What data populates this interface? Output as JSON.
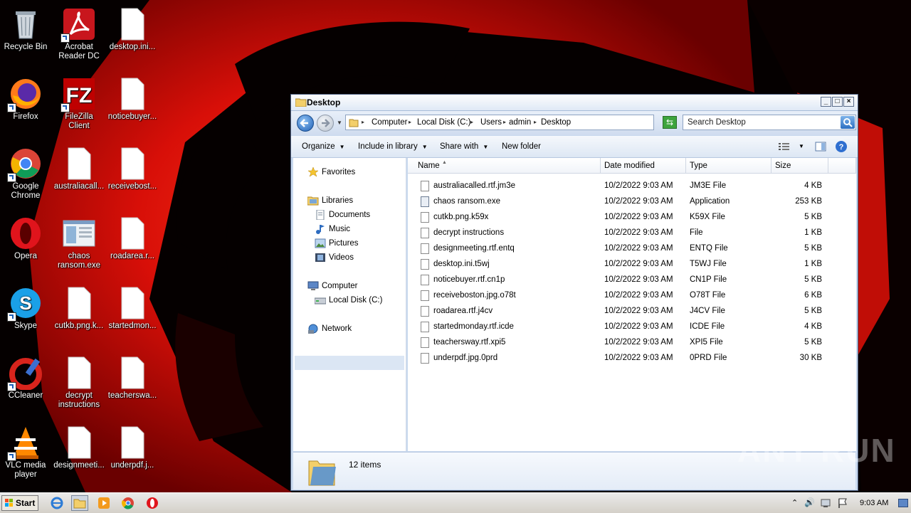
{
  "desktop": {
    "icons": [
      {
        "label": "Recycle Bin",
        "icon": "recycle-bin-icon"
      },
      {
        "label": "Acrobat Reader DC",
        "icon": "acrobat-icon"
      },
      {
        "label": "desktop.ini...",
        "icon": "file-icon"
      },
      {
        "label": "Firefox",
        "icon": "firefox-icon"
      },
      {
        "label": "FileZilla Client",
        "icon": "filezilla-icon"
      },
      {
        "label": "noticebuyer...",
        "icon": "file-icon"
      },
      {
        "label": "Google Chrome",
        "icon": "chrome-icon"
      },
      {
        "label": "australiacall...",
        "icon": "file-icon"
      },
      {
        "label": "receivebost...",
        "icon": "file-icon"
      },
      {
        "label": "Opera",
        "icon": "opera-icon"
      },
      {
        "label": "chaos ransom.exe",
        "icon": "exe-icon"
      },
      {
        "label": "roadarea.r...",
        "icon": "file-icon"
      },
      {
        "label": "Skype",
        "icon": "skype-icon"
      },
      {
        "label": "cutkb.png.k...",
        "icon": "file-icon"
      },
      {
        "label": "startedmon...",
        "icon": "file-icon"
      },
      {
        "label": "CCleaner",
        "icon": "ccleaner-icon"
      },
      {
        "label": "decrypt instructions",
        "icon": "file-icon"
      },
      {
        "label": "teacherswa...",
        "icon": "file-icon"
      },
      {
        "label": "VLC media player",
        "icon": "vlc-icon"
      },
      {
        "label": "designmeeti...",
        "icon": "file-icon"
      },
      {
        "label": "underpdf.j...",
        "icon": "file-icon"
      }
    ]
  },
  "window": {
    "title": "Desktop",
    "address": [
      "Computer",
      "Local Disk (C:)",
      "Users",
      "admin",
      "Desktop"
    ],
    "search_placeholder": "Search Desktop",
    "toolbar": {
      "organize": "Organize",
      "include": "Include in library",
      "share": "Share with",
      "new_folder": "New folder"
    },
    "nav": {
      "favorites": "Favorites",
      "libraries": "Libraries",
      "documents": "Documents",
      "music": "Music",
      "pictures": "Pictures",
      "videos": "Videos",
      "computer": "Computer",
      "local_disk": "Local Disk (C:)",
      "network": "Network"
    },
    "columns": {
      "name": "Name",
      "date": "Date modified",
      "type": "Type",
      "size": "Size"
    },
    "files": [
      {
        "name": "australiacalled.rtf.jm3e",
        "date": "10/2/2022 9:03 AM",
        "type": "JM3E File",
        "size": "4 KB"
      },
      {
        "name": "chaos ransom.exe",
        "date": "10/2/2022 9:03 AM",
        "type": "Application",
        "size": "253 KB"
      },
      {
        "name": "cutkb.png.k59x",
        "date": "10/2/2022 9:03 AM",
        "type": "K59X File",
        "size": "5 KB"
      },
      {
        "name": "decrypt instructions",
        "date": "10/2/2022 9:03 AM",
        "type": "File",
        "size": "1 KB"
      },
      {
        "name": "designmeeting.rtf.entq",
        "date": "10/2/2022 9:03 AM",
        "type": "ENTQ File",
        "size": "5 KB"
      },
      {
        "name": "desktop.ini.t5wj",
        "date": "10/2/2022 9:03 AM",
        "type": "T5WJ File",
        "size": "1 KB"
      },
      {
        "name": "noticebuyer.rtf.cn1p",
        "date": "10/2/2022 9:03 AM",
        "type": "CN1P File",
        "size": "5 KB"
      },
      {
        "name": "receiveboston.jpg.o78t",
        "date": "10/2/2022 9:03 AM",
        "type": "O78T File",
        "size": "6 KB"
      },
      {
        "name": "roadarea.rtf.j4cv",
        "date": "10/2/2022 9:03 AM",
        "type": "J4CV File",
        "size": "5 KB"
      },
      {
        "name": "startedmonday.rtf.icde",
        "date": "10/2/2022 9:03 AM",
        "type": "ICDE File",
        "size": "4 KB"
      },
      {
        "name": "teachersway.rtf.xpi5",
        "date": "10/2/2022 9:03 AM",
        "type": "XPI5 File",
        "size": "5 KB"
      },
      {
        "name": "underpdf.jpg.0prd",
        "date": "10/2/2022 9:03 AM",
        "type": "0PRD File",
        "size": "30 KB"
      }
    ],
    "status": "12 items"
  },
  "taskbar": {
    "start": "Start",
    "clock": "9:03 AM"
  },
  "watermark": "ANY RUN",
  "colors": {
    "wallpaper_red": "#e0120a",
    "titlebar": "#dfe9f6",
    "selection": "#dbe6f4"
  }
}
